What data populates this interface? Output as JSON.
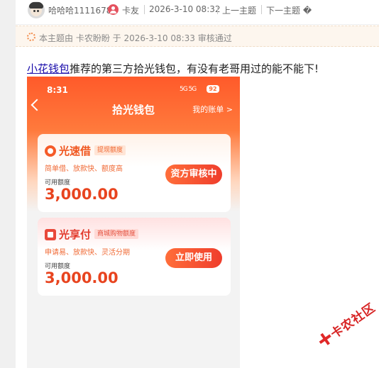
{
  "header": {
    "username": "哈哈哈1111678",
    "role": "卡友",
    "date": "2026-3-10 08:32",
    "prev_label": "上一主题",
    "next_label": "下一主题 �"
  },
  "audit_notice": {
    "text": "本主题由 卡农盼盼 于 2026-3-10 08:33 审核通过"
  },
  "post": {
    "link_text": "小花钱包",
    "body_text": "推荐的第三方拾光钱包，有没有老哥用过的能不能下!"
  },
  "screenshot": {
    "status_time": "8:31",
    "status_signal": "5G 5G",
    "battery": "92",
    "title": "拾光钱包",
    "my_bill": "我的账单 >",
    "cards": [
      {
        "name": "光速借",
        "tag": "提现额度",
        "desc": "简单借、放款快、额度高",
        "limit_label": "可用额度",
        "amount": "3,000.00",
        "button": "资方审核中"
      },
      {
        "name": "光享付",
        "tag": "商城购物额度",
        "desc": "申请易、放款快、灵活分期",
        "limit_label": "可用额度",
        "amount": "3,000.00",
        "button": "立即使用"
      }
    ]
  },
  "watermark": {
    "text": "卡农社区"
  },
  "colors": {
    "accent_orange": "#ff5a2a",
    "button_red": "#ef3d2c",
    "link_blue": "#1a0dab",
    "notice_bg": "#fdf6ee"
  }
}
